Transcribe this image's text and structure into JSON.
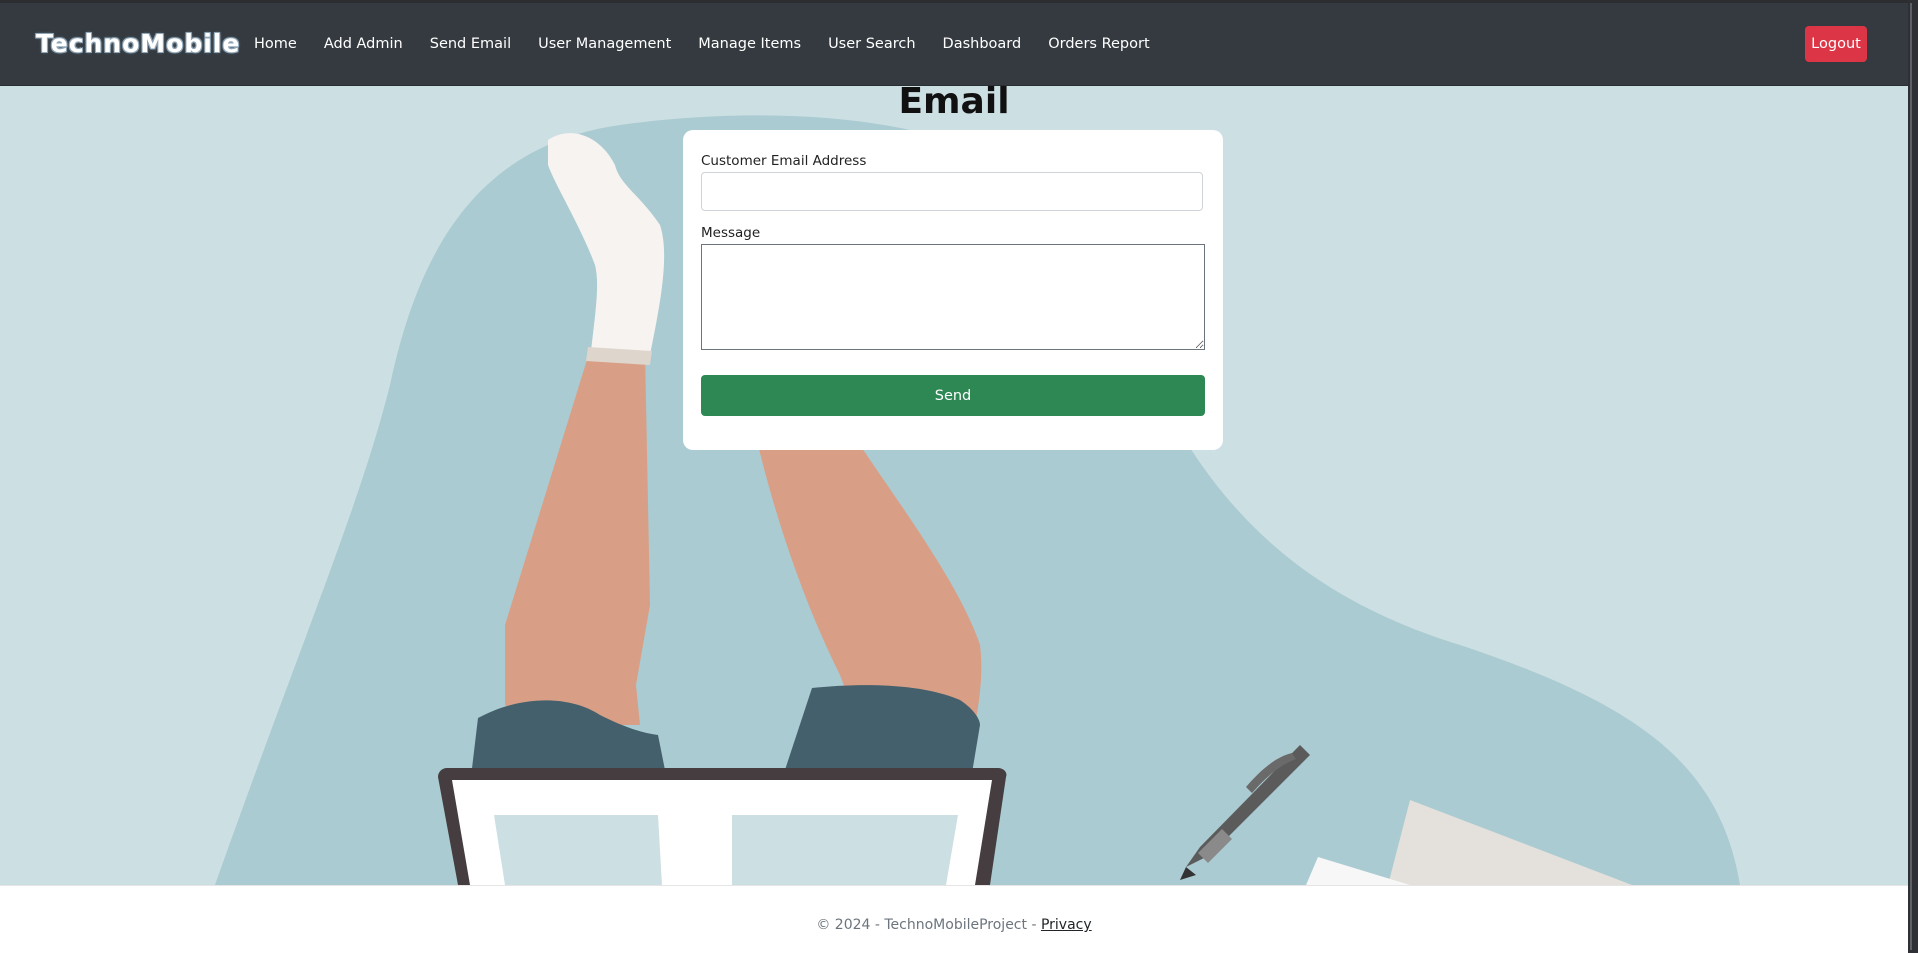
{
  "navbar": {
    "brand": "TechnoMobile",
    "links": [
      "Home",
      "Add Admin",
      "Send Email",
      "User Management",
      "Manage Items",
      "User Search",
      "Dashboard",
      "Orders Report"
    ],
    "logout_label": "Logout"
  },
  "page": {
    "title": "Email"
  },
  "form": {
    "email_label": "Customer Email Address",
    "email_value": "",
    "message_label": "Message",
    "message_value": "",
    "send_label": "Send"
  },
  "footer": {
    "copyright": "© 2024 - TechnoMobileProject - ",
    "privacy_label": "Privacy"
  },
  "colors": {
    "navbar_bg": "#343a40",
    "page_bg": "#ccdfe3",
    "blob": "#aacbd1",
    "logout": "#dc3545",
    "send": "#2e8854"
  }
}
